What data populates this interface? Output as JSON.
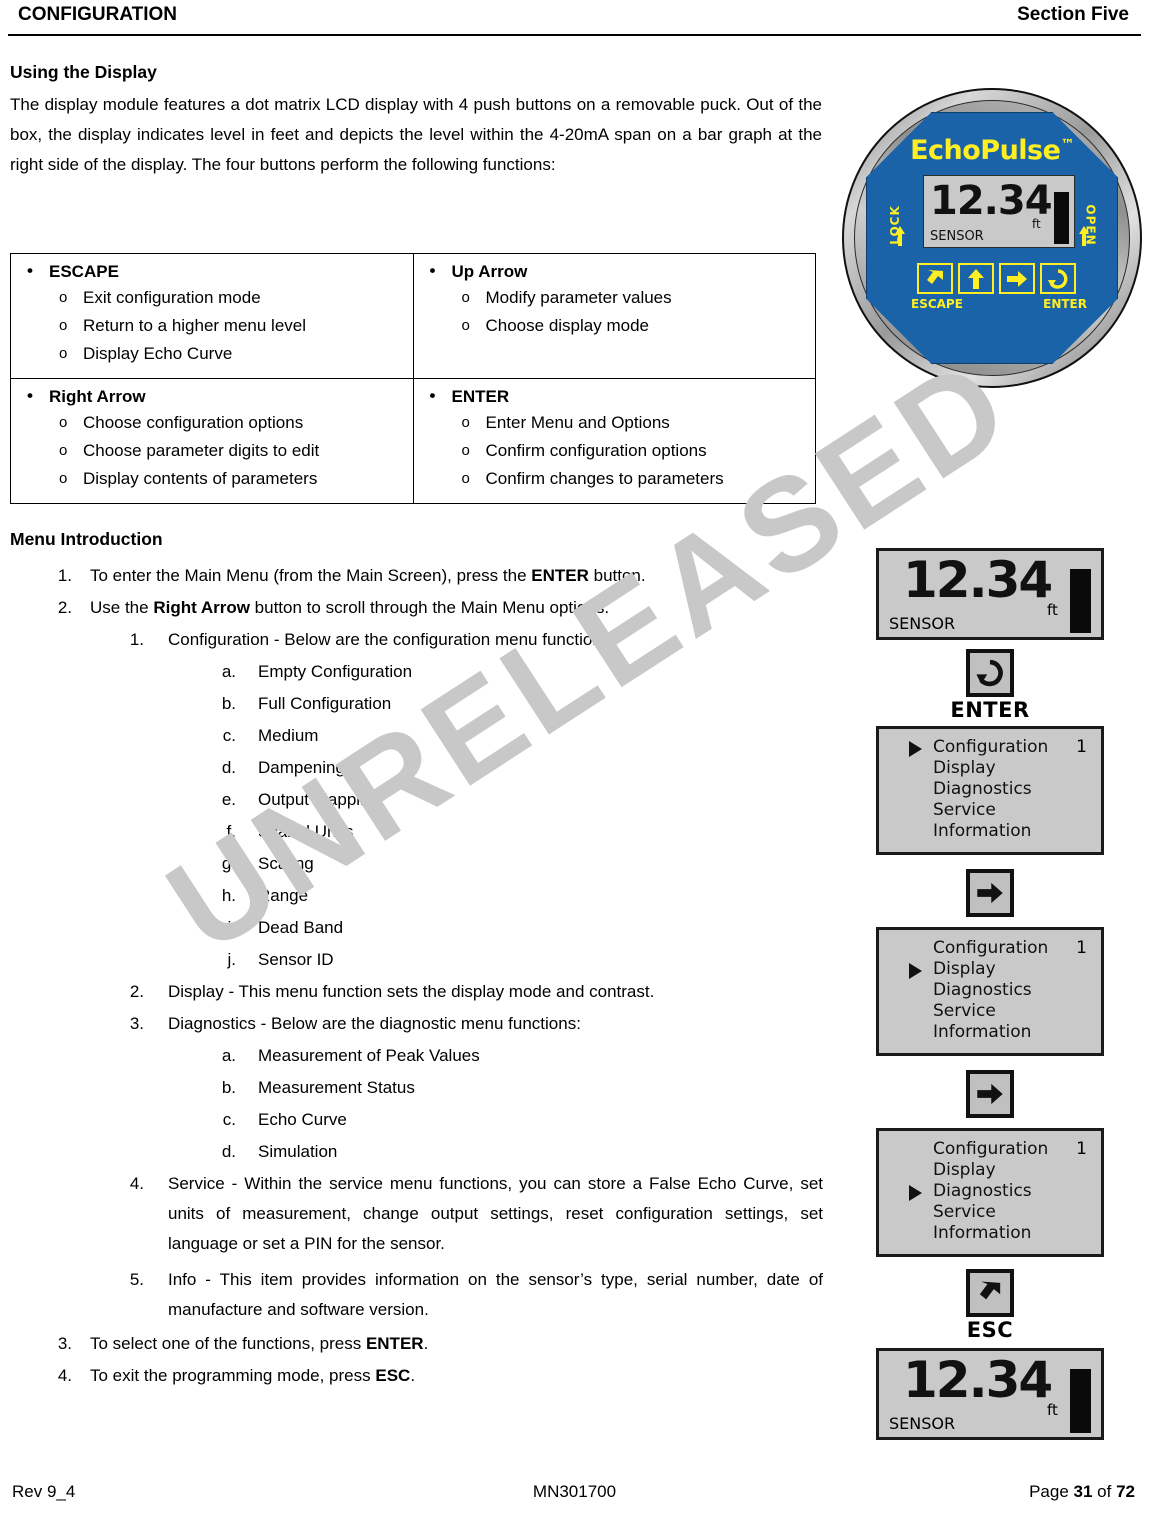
{
  "header": {
    "left": "CONFIGURATION",
    "right": "Section Five"
  },
  "section": {
    "title": "Using the Display",
    "intro": "The display module features a dot matrix LCD display with 4 push buttons on a removable puck.  Out of the box, the display indicates level in feet and depicts the level within the 4-20mA span on a bar graph at the right side of the display.  The four buttons perform the following functions:"
  },
  "key_table": [
    {
      "name": "ESCAPE",
      "items": [
        "Exit configuration mode",
        "Return to a higher menu level",
        "Display Echo Curve"
      ]
    },
    {
      "name": "Up Arrow",
      "items": [
        "Modify parameter values",
        "Choose display mode"
      ]
    },
    {
      "name": "Right Arrow",
      "items": [
        "Choose configuration options",
        "Choose parameter digits to edit",
        "Display contents of parameters"
      ]
    },
    {
      "name": "ENTER",
      "items": [
        "Enter Menu and Options",
        "Confirm configuration options",
        "Confirm changes to parameters"
      ]
    }
  ],
  "menu_intro": {
    "title": "Menu Introduction",
    "step1_marker": "1.",
    "step1_a": "To enter the Main Menu (from the Main Screen), press the ",
    "step1_b": "ENTER",
    "step1_c": " button.",
    "step2_marker": "2.",
    "step2_a": "Use the ",
    "step2_b": "Right Arrow",
    "step2_c": " button to scroll through the Main Menu options.",
    "sub1_marker": "1.",
    "sub1_text": "Configuration - Below are the configuration menu functions:",
    "config_items": [
      {
        "marker": "a.",
        "label": "Empty Configuration"
      },
      {
        "marker": "b.",
        "label": "Full Configuration"
      },
      {
        "marker": "c.",
        "label": "Medium"
      },
      {
        "marker": "d.",
        "label": "Dampening"
      },
      {
        "marker": "e.",
        "label": "Output Mapping"
      },
      {
        "marker": "f.",
        "label": "Scaled Units"
      },
      {
        "marker": "g.",
        "label": "Scaling"
      },
      {
        "marker": "h.",
        "label": "Range"
      },
      {
        "marker": "i.",
        "label": "Dead Band"
      },
      {
        "marker": "j.",
        "label": "Sensor ID"
      }
    ],
    "sub2_marker": "2.",
    "sub2_text": "Display - This menu function sets the display mode and contrast.",
    "sub3_marker": "3.",
    "sub3_text": "Diagnostics - Below are the diagnostic menu functions:",
    "diag_items": [
      {
        "marker": "a.",
        "label": "Measurement of Peak Values"
      },
      {
        "marker": "b.",
        "label": "Measurement Status"
      },
      {
        "marker": "c.",
        "label": "Echo Curve"
      },
      {
        "marker": "d.",
        "label": "Simulation"
      }
    ],
    "sub4_marker": "4.",
    "sub4_text": "Service - Within the service menu functions, you can store a False Echo Curve, set units of measurement, change output settings, reset configuration settings, set language or set a PIN for the sensor.",
    "sub5_marker": "5.",
    "sub5_text": "Info - This item provides information on the sensor’s type, serial number, date of manufacture and software version.",
    "step3_marker": "3.",
    "step3_a": "To select one of the functions, press ",
    "step3_b": "ENTER",
    "step3_c": ".",
    "step4_marker": "4.",
    "step4_a": "To exit the programming mode, press ",
    "step4_b": "ESC",
    "step4_c": "."
  },
  "device": {
    "brand": "EchoPulse",
    "trademark": "™",
    "lcd_value": "12.34",
    "lcd_unit": "ft",
    "lcd_label": "SENSOR",
    "side_lock": "LOCK",
    "side_open": "OPEN",
    "key_escape_label": "ESCAPE",
    "key_enter_label": "ENTER",
    "keys": [
      "escape-arrow-icon",
      "up-arrow-icon",
      "right-arrow-icon",
      "enter-loop-icon"
    ],
    "face_color": "#1a63a8",
    "accent_color": "#ffee22"
  },
  "flow": {
    "screen_main": {
      "value": "12.34",
      "unit": "ft",
      "label": "SENSOR"
    },
    "enter_button_label": "ENTER",
    "esc_button_label": "ESC",
    "menu_number": "1",
    "menu_items": [
      "Configuration",
      "Display",
      "Diagnostics",
      "Service",
      "Information"
    ],
    "screens": [
      {
        "selected": 0
      },
      {
        "selected": 1
      },
      {
        "selected": 2
      }
    ]
  },
  "watermark": "UNRELEASED",
  "footer": {
    "rev": "Rev 9_4",
    "doc": "MN301700",
    "page_prefix": "Page ",
    "page_num": "31",
    "page_mid": " of ",
    "page_total": "72"
  }
}
